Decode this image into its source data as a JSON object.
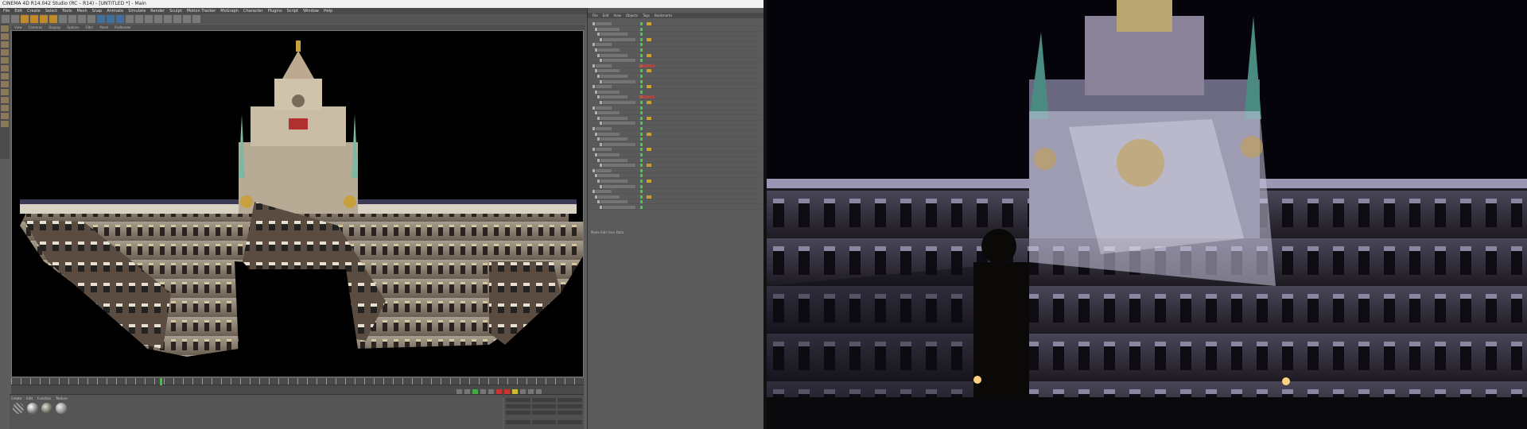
{
  "app": {
    "title": "CINEMA 4D R14.042 Studio (RC – R14) - [UNTITLED *] - Main"
  },
  "menubar": {
    "items": [
      "File",
      "Edit",
      "Create",
      "Select",
      "Tools",
      "Mesh",
      "Snap",
      "Animate",
      "Simulate",
      "Render",
      "Sculpt",
      "Motion Tracker",
      "MoGraph",
      "Character",
      "Plugins",
      "Script",
      "Window",
      "Help"
    ]
  },
  "viewport_menu": {
    "items": [
      "View",
      "Cameras",
      "Display",
      "Options",
      "Filter",
      "Panel",
      "ProRender"
    ]
  },
  "object_manager": {
    "menu": [
      "File",
      "Edit",
      "View",
      "Objects",
      "Tags",
      "Bookmarks"
    ],
    "footer": "Mode  Edit  User Data",
    "rows": 36
  },
  "material_panel": {
    "menu": [
      "Create",
      "Edit",
      "Function",
      "Texture"
    ]
  },
  "timeline": {
    "playhead_percent": 26
  },
  "colors": {
    "accent": "#c08a2a",
    "ui_bg": "#5d5d5d",
    "keyframe": "#33cc33"
  },
  "images": {
    "left_render": "building-facade-projection-mapping-render",
    "right_photo": "night-projection-on-city-hall-photo"
  }
}
